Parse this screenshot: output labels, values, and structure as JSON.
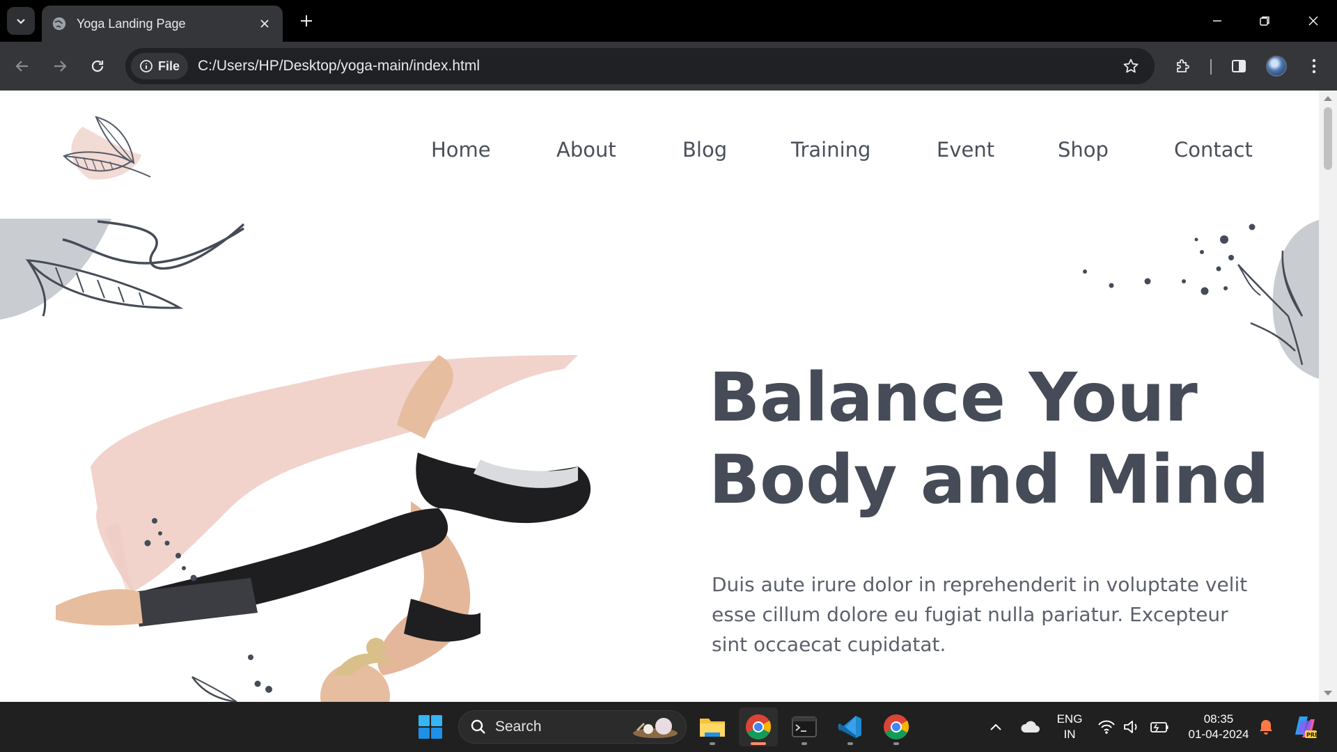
{
  "browser": {
    "tab_title": "Yoga Landing Page",
    "url_chip": "File",
    "url": "C:/Users/HP/Desktop/yoga-main/index.html"
  },
  "page": {
    "nav": [
      "Home",
      "About",
      "Blog",
      "Training",
      "Event",
      "Shop",
      "Contact"
    ],
    "hero_title_line1": "Balance Your",
    "hero_title_line2": "Body and Mind",
    "hero_text": "Duis aute irure dolor in reprehenderit in voluptate velit esse cillum dolore eu fugiat nulla pariatur. Excepteur sint occaecat cupidatat.",
    "colors": {
      "heading": "#454b57",
      "body_text": "#5c606b",
      "brush_pink": "#eecbc3",
      "blob_grey": "#c9ccd1"
    }
  },
  "taskbar": {
    "search_label": "Search",
    "lang_top": "ENG",
    "lang_bottom": "IN",
    "time": "08:35",
    "date": "01-04-2024"
  }
}
